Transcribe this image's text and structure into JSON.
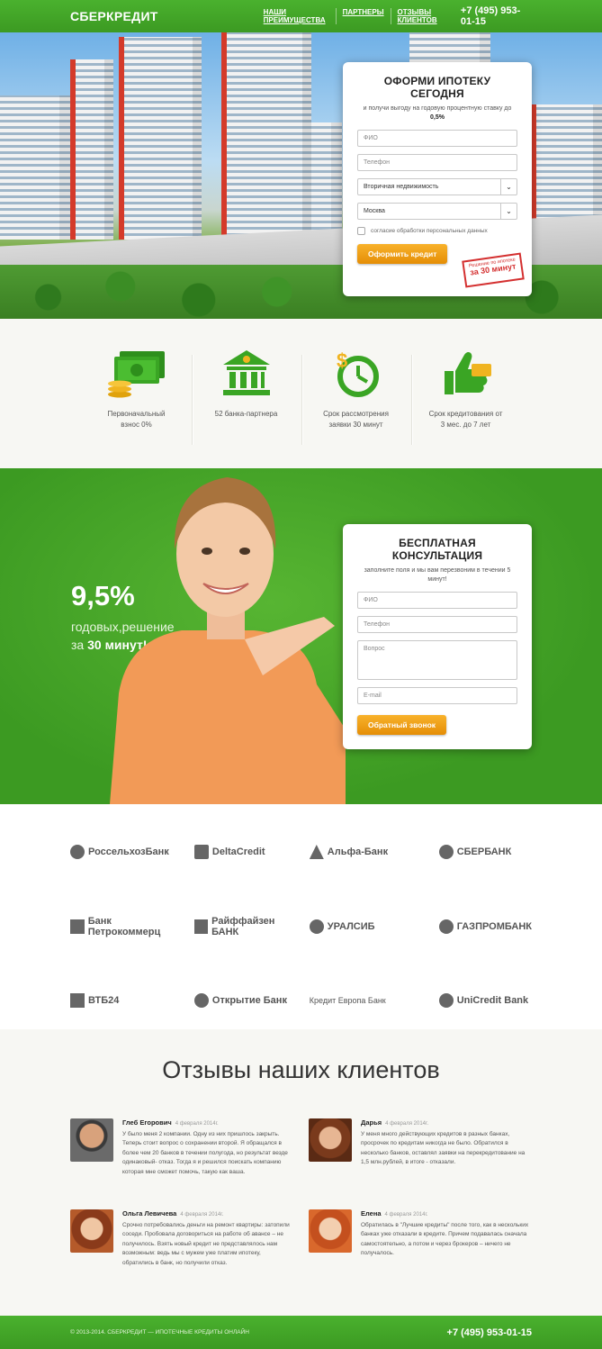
{
  "header": {
    "logo": "СБЕРКРЕДИТ",
    "nav": [
      "НАШИ ПРЕИМУЩЕСТВА",
      "ПАРТНЕРЫ",
      "ОТЗЫВЫ КЛИЕНТОВ"
    ],
    "phone": "+7 (495) 953-01-15"
  },
  "hero_form": {
    "title": "ОФОРМИ ИПОТЕКУ СЕГОДНЯ",
    "subtitle_pre": "и получи выгоду на годовую процентную ставку до",
    "subtitle_rate": "0,5%",
    "name_placeholder": "ФИО",
    "phone_placeholder": "Телефон",
    "property_type": "Вторичная недвижимость",
    "city": "Москва",
    "consent": "согласие обработки персональных данных",
    "submit": "Оформить кредит",
    "stamp_top": "Решение по ипотеке",
    "stamp_main": "за 30 минут"
  },
  "features": [
    {
      "label": "Первоначальный взнос 0%",
      "icon": "money-stack-icon"
    },
    {
      "label": "52 банка-партнера",
      "icon": "bank-building-icon"
    },
    {
      "label": "Срок рассмотрения заявки 30 минут",
      "icon": "dollar-clock-icon"
    },
    {
      "label": "Срок кредитования от 3 мес. до 7 лет",
      "icon": "thumbs-up-card-icon"
    }
  ],
  "consult": {
    "rate": "9,5%",
    "line1": "годовых,решение",
    "line2_pre": "за",
    "line2_bold": "30 минут!",
    "title": "БЕСПЛАТНАЯ КОНСУЛЬТАЦИЯ",
    "subtitle": "заполните поля и мы вам перезвоним в течении 5 минут!",
    "name_placeholder": "ФИО",
    "phone_placeholder": "Телефон",
    "question_placeholder": "Вопрос",
    "email_placeholder": "E-mail",
    "submit": "Обратный звонок"
  },
  "banks": [
    "РоссельхозБанк",
    "DeltaCredit",
    "Альфа-Банк",
    "СБЕРБАНК",
    "Банк Петрокоммерц",
    "Райффайзен БАНК",
    "УРАЛСИБ",
    "ГАЗПРОМБАНК",
    "ВТБ24",
    "Открытие Банк",
    "Кредит Европа Банк",
    "UniCredit Bank"
  ],
  "reviews": {
    "title": "Отзывы наших клиентов",
    "items": [
      {
        "name": "Глеб Егорович",
        "date": "4 февраля 2014г.",
        "text": "У было меня 2 компании. Одну из них пришлось закрыть. Теперь стоит вопрос о сохранении второй. Я обращался в более чем 20 банков в течении полугода, но результат везде одинаковый- отказ. Тогда я и решился поискать компанию которая мне сможет помочь, такую как ваша."
      },
      {
        "name": "Дарья",
        "date": "4 февраля 2014г.",
        "text": "У меня много действующих кредитов в разных банках, просрочек по кредитам никогда не было. Обратился в несколько банков, оставлял заявки на перекредитование на 1,5 млн.рублей, в итоге - отказали."
      },
      {
        "name": "Ольга Левичева",
        "date": "4 февраля 2014г.",
        "text": "Срочно потребовались деньги на ремонт квартиры: затопили соседи. Пробовала договориться на работе об авансе – не получилось. Взять новый кредит не представлялось нам возможным: ведь мы с мужем уже платим ипотеку, обратились в банк, но получили отказ."
      },
      {
        "name": "Елена",
        "date": "4 февраля 2014г.",
        "text": "Обратилась в \"Лучшие кредиты\" после того, как в нескольких банках уже отказали в кредите. Причем подавалась сначала самостоятельно, а потом и через брокеров – ничего не получалось."
      }
    ]
  },
  "footer": {
    "copyright": "© 2013-2014. СБЕРКРЕДИТ — ИПОТЕЧНЫЕ КРЕДИТЫ ОНЛАЙН",
    "phone": "+7 (495) 953-01-15"
  },
  "colors": {
    "brand_green": "#3fa526",
    "accent_orange": "#f0a117"
  }
}
